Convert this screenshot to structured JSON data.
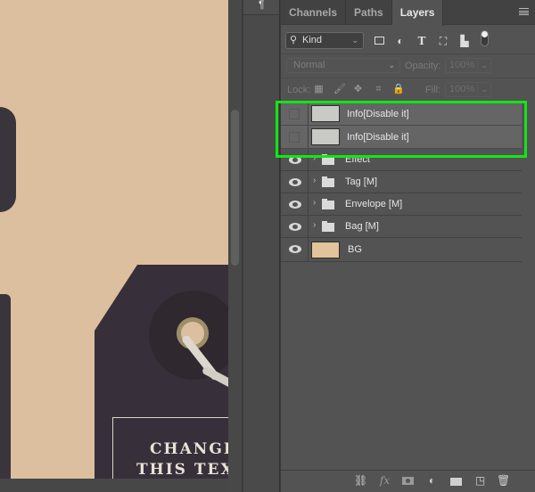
{
  "canvas": {
    "tag_text_line1": "CHANGE",
    "tag_text_line2": "THIS TEXT",
    "background_color": "#dcbf9e"
  },
  "dock": {
    "icon": "paragraph-icon"
  },
  "panel": {
    "tabs": [
      {
        "label": "Channels",
        "active": false
      },
      {
        "label": "Paths",
        "active": false
      },
      {
        "label": "Layers",
        "active": true
      }
    ],
    "filter": {
      "kind_label": "Kind",
      "icons": [
        "pixel-layer-filter-icon",
        "adjustment-layer-filter-icon",
        "type-layer-filter-icon",
        "shape-layer-filter-icon",
        "smart-object-filter-icon"
      ]
    },
    "blend_mode": "Normal",
    "opacity_label": "Opacity:",
    "opacity_value": "100%",
    "lock_label": "Lock:",
    "fill_label": "Fill:",
    "fill_value": "100%",
    "layers": [
      {
        "name": "Info[Disable it]",
        "type": "layer",
        "visible": false,
        "selected": true
      },
      {
        "name": "Info[Disable it]",
        "type": "layer",
        "visible": false,
        "selected": true
      },
      {
        "name": "Effect",
        "type": "group",
        "visible": true
      },
      {
        "name": "Tag [M]",
        "type": "group",
        "visible": true
      },
      {
        "name": "Envelope [M]",
        "type": "group",
        "visible": true
      },
      {
        "name": "Bag [M]",
        "type": "group",
        "visible": true
      },
      {
        "name": "BG",
        "type": "fill",
        "visible": true,
        "color": "#e2c49b"
      }
    ],
    "footer_icons": [
      "link-layers-icon",
      "fx-icon",
      "add-mask-icon",
      "adjustment-layer-icon",
      "new-group-icon",
      "new-layer-icon",
      "delete-layer-icon"
    ],
    "highlight_color": "#11e615"
  }
}
